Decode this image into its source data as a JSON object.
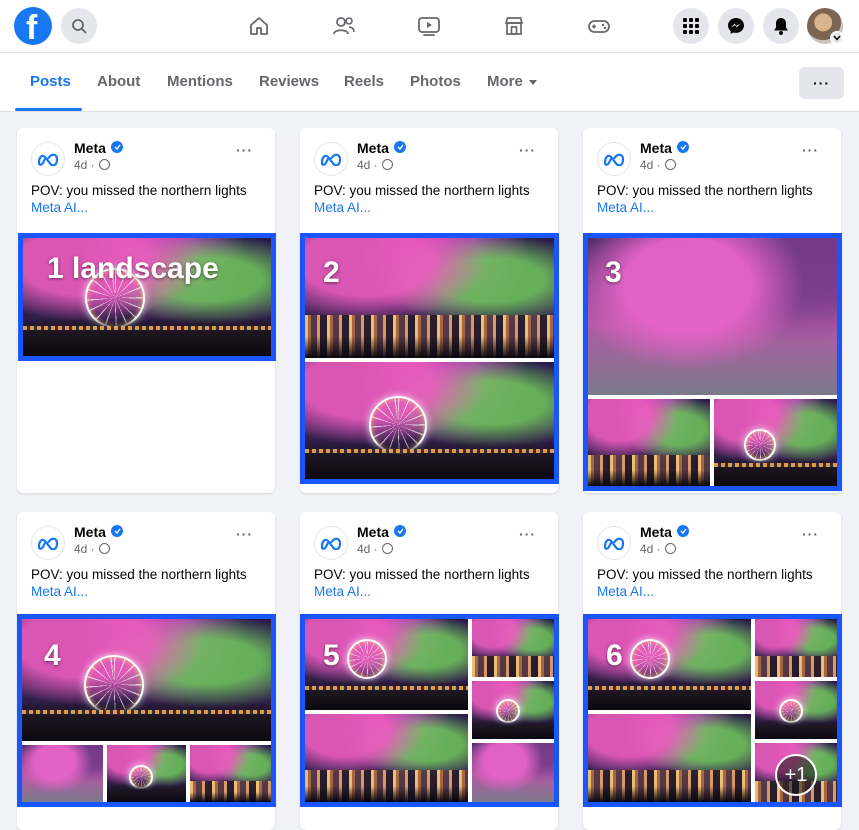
{
  "topbar": {
    "logo_letter": "f",
    "icons": [
      "facebook-logo",
      "search-icon",
      "home-icon",
      "friends-icon",
      "watch-icon",
      "marketplace-icon",
      "gaming-icon",
      "menu-grid-icon",
      "messenger-icon",
      "bell-icon",
      "avatar",
      "chevron-down-icon"
    ]
  },
  "tabs": {
    "items": [
      "Posts",
      "About",
      "Mentions",
      "Reviews",
      "Reels",
      "Photos",
      "More"
    ],
    "active": "Posts",
    "more_button": "···"
  },
  "posts": [
    {
      "author": "Meta",
      "time": "4d ·",
      "caption": "POV: you missed the northern lights",
      "more": "Meta AI...",
      "menu": "···",
      "label": "1 landscape"
    },
    {
      "author": "Meta",
      "time": "4d ·",
      "caption": "POV: you missed the northern lights",
      "more": "Meta AI...",
      "menu": "···",
      "label": "2"
    },
    {
      "author": "Meta",
      "time": "4d ·",
      "caption": "POV: you missed the northern lights",
      "more": "Meta AI...",
      "menu": "···",
      "label": "3"
    },
    {
      "author": "Meta",
      "time": "4d ·",
      "caption": "POV: you missed the northern lights",
      "more": "Meta AI...",
      "menu": "···",
      "label": "4"
    },
    {
      "author": "Meta",
      "time": "4d ·",
      "caption": "POV: you missed the northern lights",
      "more": "Meta AI...",
      "menu": "···",
      "label": "5"
    },
    {
      "author": "Meta",
      "time": "4d ·",
      "caption": "POV: you missed the northern lights",
      "more": "Meta AI...",
      "menu": "···",
      "label": "6",
      "extra": "+1"
    }
  ],
  "colors": {
    "brand": "#1877f2",
    "highlight_frame": "#1a56ff"
  }
}
